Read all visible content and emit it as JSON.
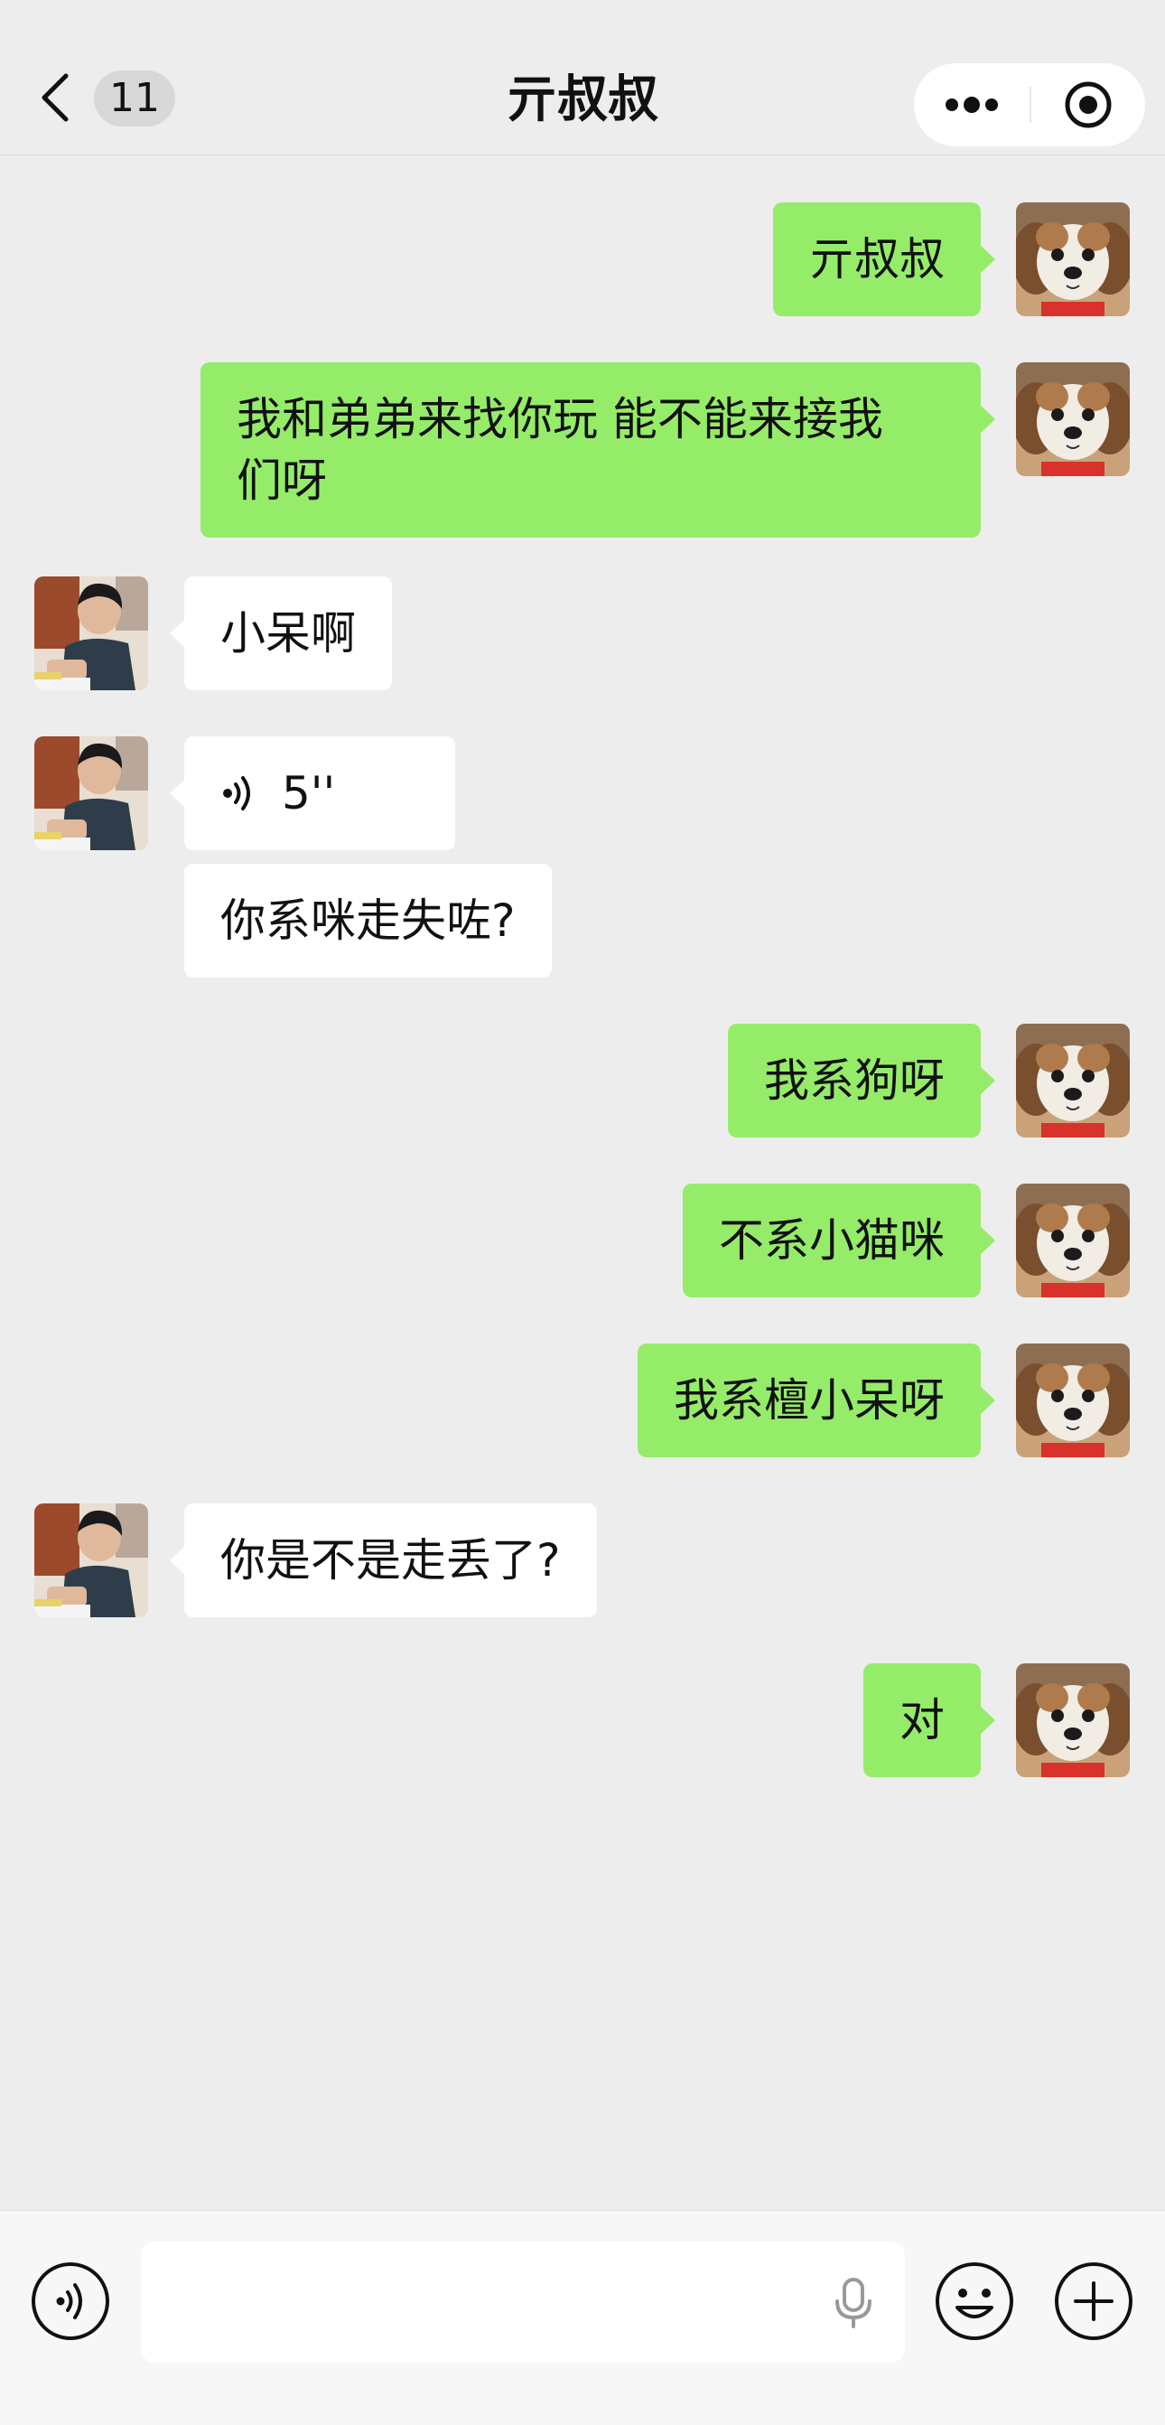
{
  "header": {
    "back_icon": "chevron-left-icon",
    "unread_count": "11",
    "title": "亓叔叔",
    "more_icon": "more-dots-icon",
    "target_icon": "target-icon"
  },
  "messages": [
    {
      "side": "me",
      "text": "亓叔叔"
    },
    {
      "side": "me",
      "text": "我和弟弟来找你玩 能不能来接我\n们呀"
    },
    {
      "side": "other",
      "text": "小呆啊"
    },
    {
      "side": "other",
      "type": "voice",
      "text": "5''"
    },
    {
      "side": "other",
      "text": "你系咪走失咗?"
    },
    {
      "side": "me",
      "text": "我系狗呀"
    },
    {
      "side": "me",
      "text": "不系小猫咪"
    },
    {
      "side": "me",
      "text": "我系檀小呆呀"
    },
    {
      "side": "other",
      "text": "你是不是走丢了?"
    },
    {
      "side": "me",
      "text": "对"
    }
  ],
  "input_bar": {
    "voice_icon": "voice-mode-icon",
    "mic_icon": "mic-icon",
    "emoji_icon": "emoji-icon",
    "plus_icon": "plus-icon",
    "value": ""
  },
  "colors": {
    "my_bubble": "#95ec69",
    "their_bubble": "#ffffff",
    "background": "#ededed"
  }
}
